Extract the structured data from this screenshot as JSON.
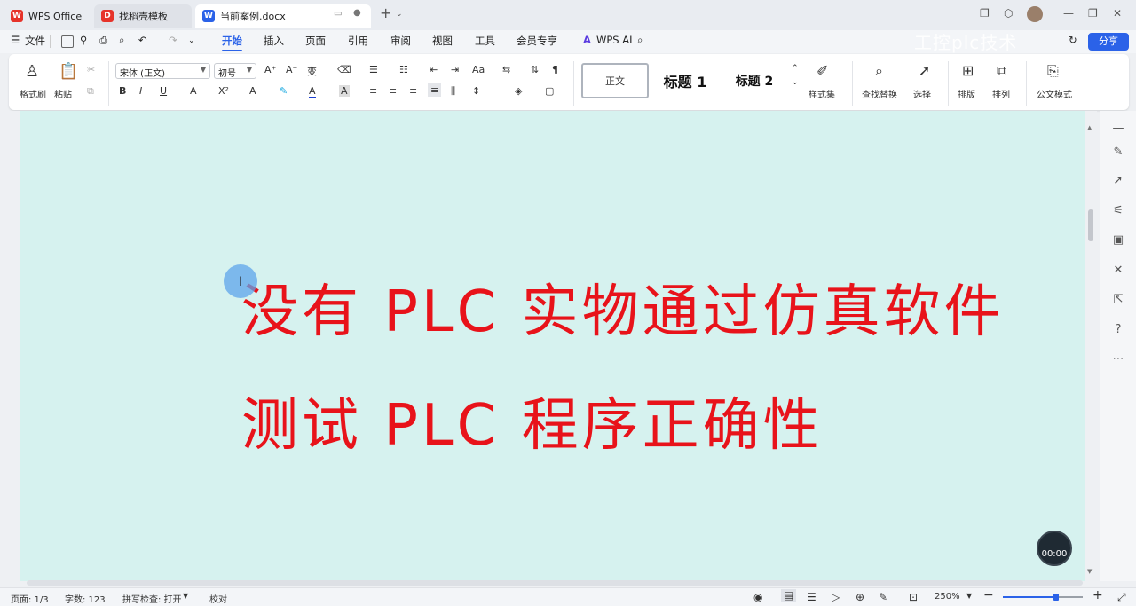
{
  "tabs": [
    {
      "label": "WPS Office",
      "icon": "wps-logo-icon",
      "color": "#e6332a"
    },
    {
      "label": "找稻壳模板",
      "icon": "docer-icon",
      "color": "#e6332a"
    },
    {
      "label": "当前案例.docx",
      "icon": "word-doc-icon",
      "color": "#2b62e8"
    }
  ],
  "menu": {
    "file": "文件",
    "items": [
      "开始",
      "插入",
      "页面",
      "引用",
      "审阅",
      "视图",
      "工具",
      "会员专享"
    ],
    "active": "开始",
    "wps_ai": "WPS AI",
    "share": "分享"
  },
  "ribbon": {
    "format_painter": "格式刷",
    "paste": "粘贴",
    "font_name": "宋体 (正文)",
    "font_size": "初号",
    "styles": [
      "正文",
      "标题 1",
      "标题 2"
    ],
    "style_set": "样式集",
    "find_replace": "查找替换",
    "select": "选择",
    "layout": "排版",
    "arrange": "排列",
    "official_mode": "公文模式"
  },
  "document": {
    "line1": "没有 PLC 实物通过仿真软件",
    "line2": "测试 PLC 程序正确性",
    "text_color": "#e8131a",
    "page_color": "#d6f2ef"
  },
  "watermark": "工控plc技术",
  "timer": "00:00",
  "status": {
    "page": "页面: 1/3",
    "words": "字数: 123",
    "spell": "拼写检查: 打开",
    "proof": "校对",
    "zoom": "250%"
  },
  "colors": {
    "accent": "#2b62e8"
  }
}
